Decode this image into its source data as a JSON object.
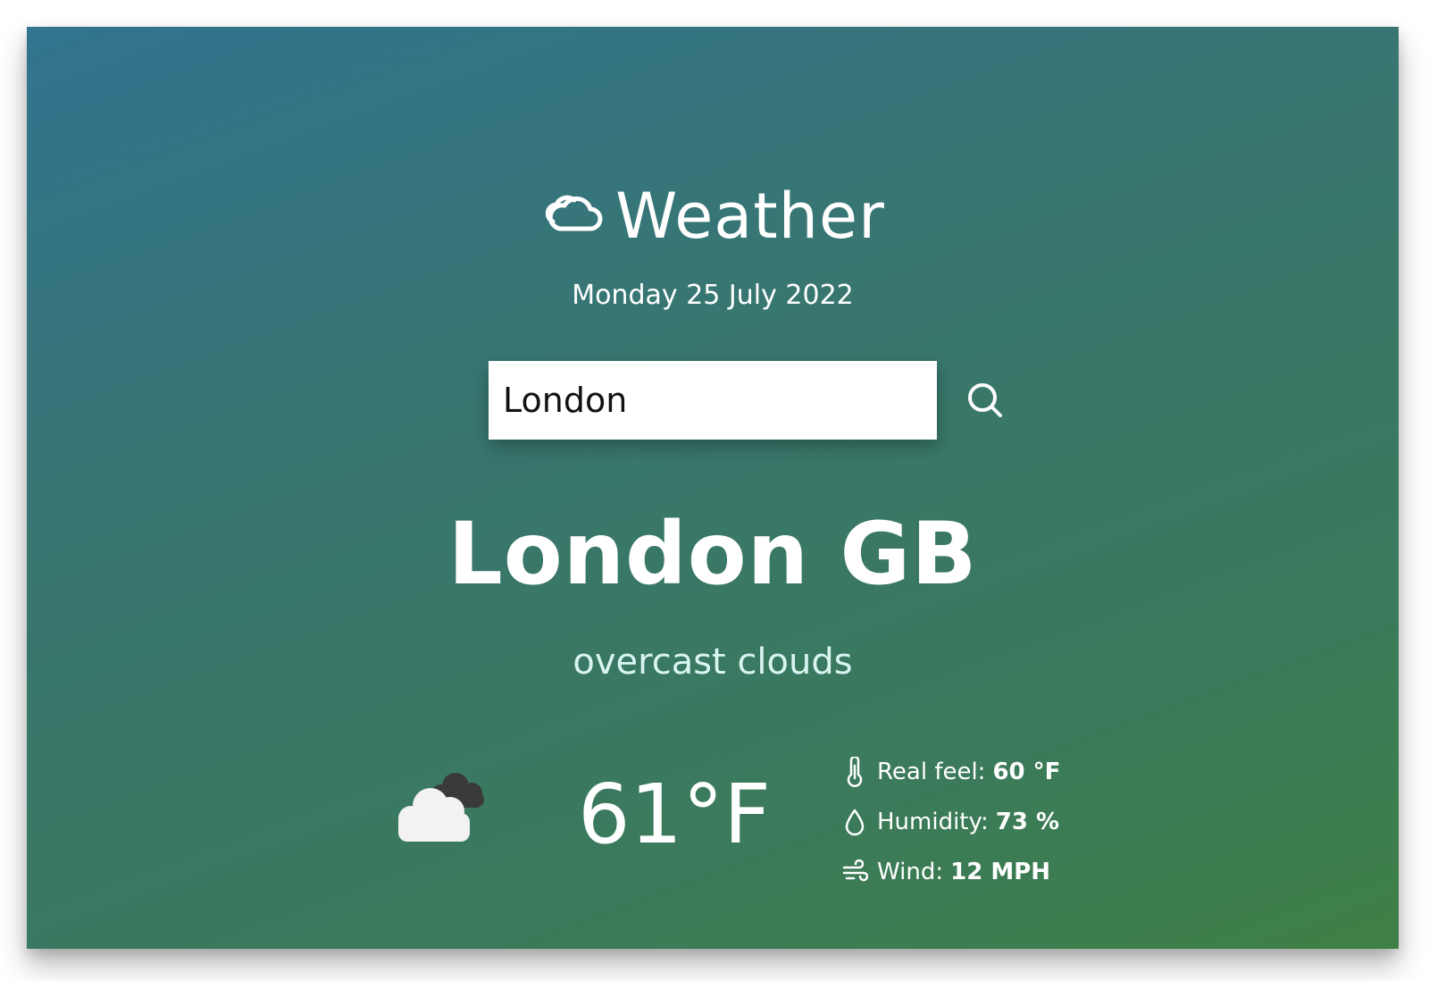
{
  "header": {
    "icon": "cloud-icon",
    "title": "Weather",
    "date": "Monday 25 July 2022"
  },
  "search": {
    "value": "London",
    "placeholder": "",
    "button_icon": "search-icon"
  },
  "location": {
    "city": "London GB",
    "condition": "overcast clouds"
  },
  "current": {
    "icon": "overcast-clouds-icon",
    "temperature": "61°F",
    "details": [
      {
        "icon": "thermometer-icon",
        "label": "Real feel:",
        "value": "60 °F"
      },
      {
        "icon": "droplet-icon",
        "label": "Humidity:",
        "value": "73 %"
      },
      {
        "icon": "wind-icon",
        "label": "Wind:",
        "value": "12 MPH"
      }
    ]
  },
  "colors": {
    "gradient_start": "#33748f",
    "gradient_end": "#3e8046",
    "text": "#ffffff",
    "condition_text": "#d8f5f2"
  }
}
